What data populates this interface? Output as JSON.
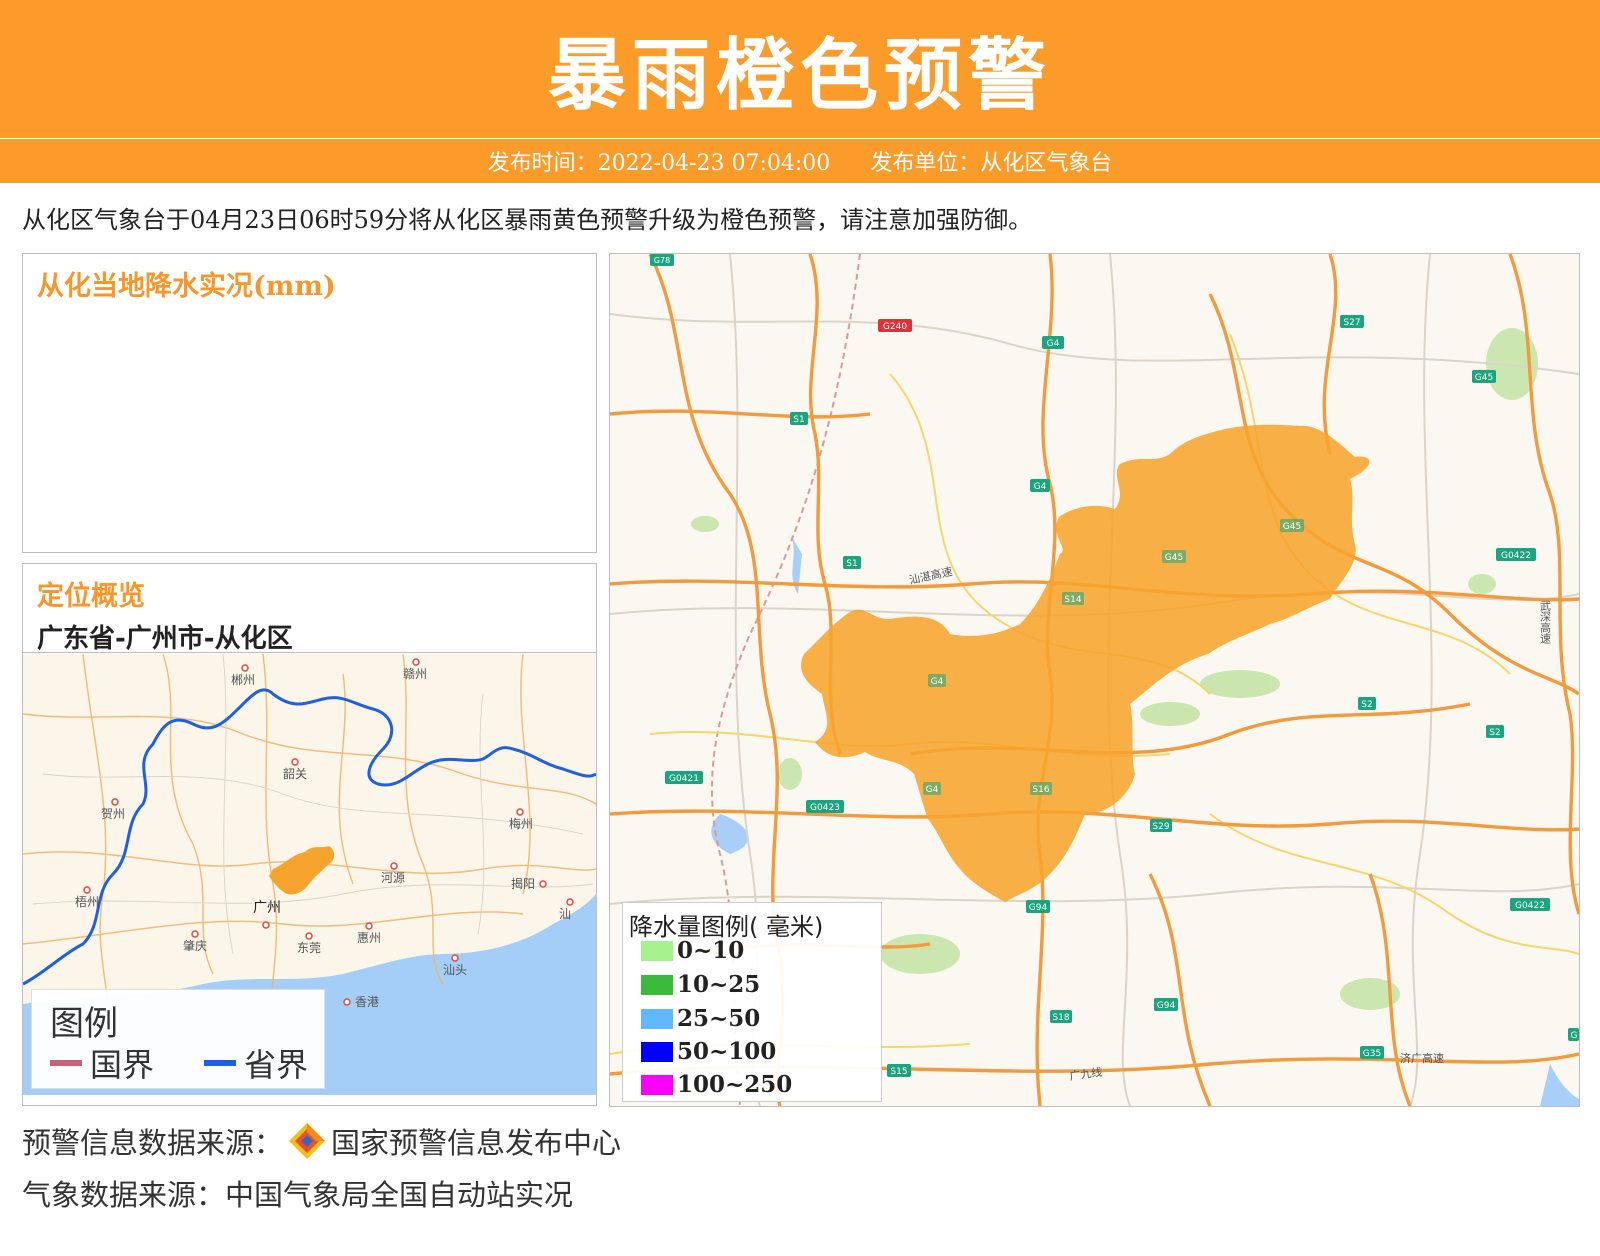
{
  "header": {
    "title": "暴雨橙色预警",
    "publish_time": "发布时间：2022-04-23 07:04:00",
    "publisher": "发布单位：从化区气象台"
  },
  "summary": "从化区气象台于04月23日06时59分将从化区暴雨黄色预警升级为橙色预警，请注意加强防御。",
  "rain_panel": {
    "title": "从化当地降水实况(mm)"
  },
  "location_panel": {
    "title": "定位概览",
    "path": "广东省-广州市-从化区",
    "cities": [
      "郴州",
      "赣州",
      "韶关",
      "贺州",
      "梅州",
      "河源",
      "揭阳",
      "梧州",
      "广州",
      "肇庆",
      "东莞",
      "惠州",
      "汕头",
      "汕",
      "香港"
    ],
    "legend": {
      "title": "图例",
      "items": [
        {
          "label": "国界",
          "color": "#c8627a"
        },
        {
          "label": "省界",
          "color": "#1f5fe0"
        }
      ]
    }
  },
  "main_map": {
    "road_labels": [
      "G78",
      "G240",
      "G4",
      "S27",
      "G45",
      "S1",
      "G4",
      "G45",
      "S1",
      "S14",
      "G45",
      "G0422",
      "G4",
      "S2",
      "S2",
      "G0421",
      "G0423",
      "G4",
      "S16",
      "S29",
      "G94",
      "G0422",
      "S18",
      "G94",
      "G35",
      "S15",
      "G"
    ],
    "place_labels": [
      "汕湛高速",
      "武深高速",
      "广九线",
      "济广高速"
    ],
    "legend": {
      "title": "降水量图例( 毫米)",
      "items": [
        {
          "label": "0~10",
          "color": "#a6f28f"
        },
        {
          "label": "10~25",
          "color": "#3dba3d"
        },
        {
          "label": "25~50",
          "color": "#61b8ff"
        },
        {
          "label": "50~100",
          "color": "#0000fe"
        },
        {
          "label": "100~250",
          "color": "#fa00fa"
        }
      ]
    }
  },
  "footer": {
    "warning_source": "预警信息数据来源：",
    "warning_source_name": "国家预警信息发布中心",
    "weather_source": "气象数据来源：中国气象局全国自动站实况"
  },
  "colors": {
    "accent": "#fa9b2a",
    "district_fill": "#f7a42e"
  }
}
